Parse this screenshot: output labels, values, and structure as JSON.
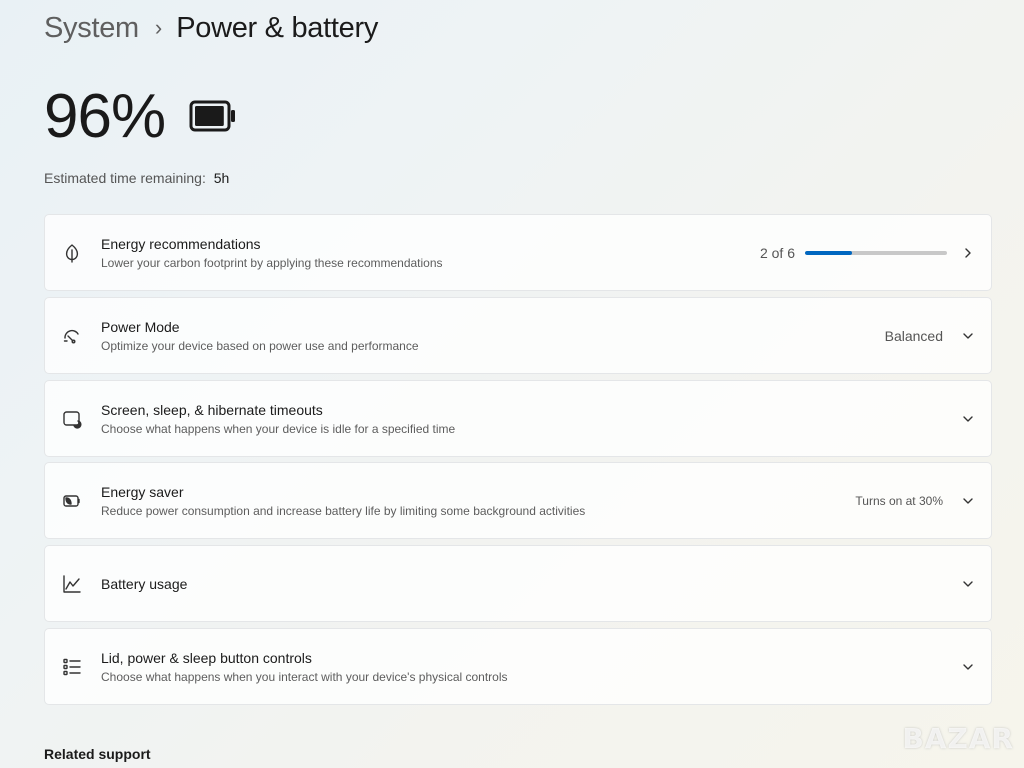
{
  "breadcrumb": {
    "parent": "System",
    "separator": "›",
    "current": "Power & battery"
  },
  "battery": {
    "percent": "96%",
    "level": 0.96,
    "icon": "battery-full-icon",
    "time_label": "Estimated time remaining:",
    "time_value": "5h"
  },
  "cards": [
    {
      "id": "energy-recommendations",
      "icon": "leaf-icon",
      "title": "Energy recommendations",
      "subtitle": "Lower your carbon footprint by applying these recommendations",
      "right_value": "2 of 6",
      "progress": 0.333,
      "control": "chevron-right-icon"
    },
    {
      "id": "power-mode",
      "icon": "gauge-icon",
      "title": "Power Mode",
      "subtitle": "Optimize your device based on power use and performance",
      "right_value": "Balanced",
      "control": "chevron-down-icon"
    },
    {
      "id": "screen-sleep",
      "icon": "screen-sleep-icon",
      "title": "Screen, sleep, & hibernate timeouts",
      "subtitle": "Choose what happens when your device is idle for a specified time",
      "control": "chevron-down-icon"
    },
    {
      "id": "energy-saver",
      "icon": "energy-saver-icon",
      "title": "Energy saver",
      "subtitle": "Reduce power consumption and increase battery life by limiting some background activities",
      "right_value": "Turns on at 30%",
      "control": "chevron-down-icon"
    },
    {
      "id": "battery-usage",
      "icon": "line-chart-icon",
      "title": "Battery usage",
      "control": "chevron-down-icon"
    },
    {
      "id": "lid-power",
      "icon": "list-settings-icon",
      "title": "Lid, power & sleep button controls",
      "subtitle": "Choose what happens when you interact with your device's physical controls",
      "control": "chevron-down-icon"
    }
  ],
  "related_support": "Related support",
  "watermark": "BAZAR",
  "colors": {
    "accent": "#0067c0",
    "track": "#c8c8c8",
    "text": "#1b1b1b",
    "secondary_text": "#5d5d5d"
  }
}
